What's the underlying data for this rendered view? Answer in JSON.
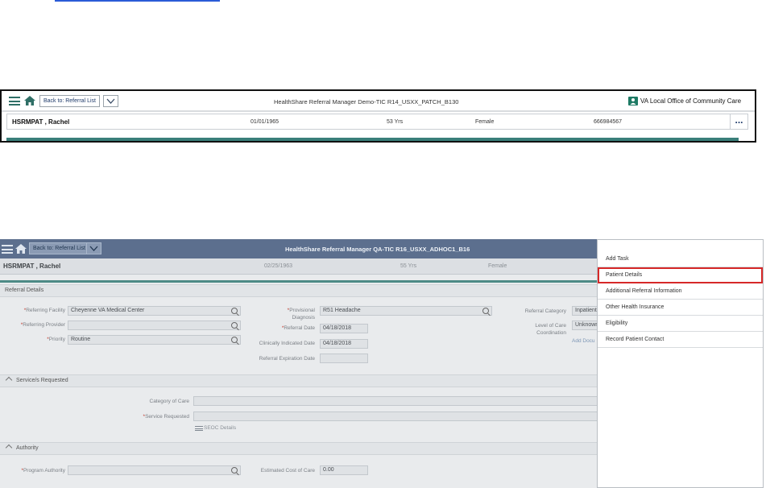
{
  "screenshot1": {
    "header": {
      "back_label": "Back to: Referral List",
      "title": "HealthShare Referral Manager Demo-TIC R14_USXX_PATCH_B130",
      "office": "VA Local Office of Community Care"
    },
    "patient": {
      "name": "HSRMPAT , Rachel",
      "dob": "01/01/1965",
      "age": "53 Yrs",
      "gender": "Female",
      "id": "666984567",
      "more_label": "..."
    }
  },
  "screenshot2": {
    "header": {
      "back_label": "Back to: Referral List",
      "title": "HealthShare Referral Manager QA-TIC R16_USXX_ADHOC1_B16"
    },
    "patient": {
      "name": "HSRMPAT , Rachel",
      "dob": "02/25/1963",
      "age": "55 Yrs",
      "gender": "Female"
    },
    "referral_details": {
      "section_title": "Referral Details",
      "referring_facility_label": "Referring Facility",
      "referring_facility_value": "Cheyenne VA Medical Center",
      "referring_provider_label": "Referring Provider",
      "referring_provider_value": "",
      "priority_label": "Priority",
      "priority_value": "Routine",
      "provisional_diagnosis_label_1": "Provisional",
      "provisional_diagnosis_label_2": "Diagnosis",
      "provisional_diagnosis_value": "R51 Headache",
      "referral_date_label": "Referral Date",
      "referral_date_value": "04/18/2018",
      "clinically_indicated_label": "Clinically Indicated Date",
      "clinically_indicated_value": "04/18/2018",
      "expiration_label": "Referral Expiration Date",
      "expiration_value": "",
      "category_label": "Referral Category",
      "category_value": "Inpatient",
      "level_of_care_label_1": "Level of Care",
      "level_of_care_label_2": "Coordination",
      "level_of_care_value": "Unknown",
      "add_docs_label": "Add Docu"
    },
    "services_requested": {
      "section_title": "Service/s Requested",
      "category_of_care_label": "Category of Care",
      "service_requested_label": "Service Requested",
      "sedc_label": "SEOC Details"
    },
    "authority": {
      "section_title": "Authority",
      "program_authority_label": "Program Authority",
      "program_authority_value": "",
      "estimated_cost_label": "Estimated Cost of Care",
      "estimated_cost_value": "0.00"
    }
  },
  "menu": {
    "items": [
      {
        "label": "Add Task"
      },
      {
        "label": "Patient Details"
      },
      {
        "label": "Additional Referral Information"
      },
      {
        "label": "Other Health Insurance"
      },
      {
        "label": "Eligibility"
      },
      {
        "label": "Record Patient Contact"
      }
    ],
    "highlight_color": "#d62828"
  },
  "colors": {
    "accent": "#1d7a64",
    "header_bar_dim": "#5c6f8e",
    "teal_rule": "#3a7f7a"
  }
}
